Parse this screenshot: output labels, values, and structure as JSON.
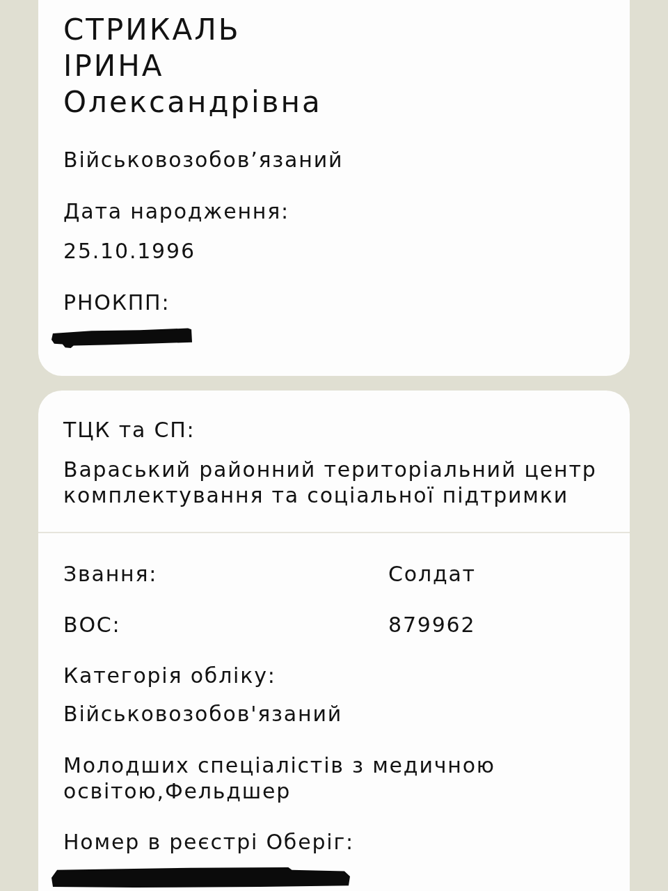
{
  "person_card": {
    "name_lines": [
      "СТРИКАЛЬ",
      "ІРИНА",
      "Олександрівна"
    ],
    "status": "Військовозобов’язаний",
    "fields": [
      {
        "label": "Дата народження:",
        "value": "25.10.1996",
        "redacted": false
      },
      {
        "label": "РНОКПП:",
        "redacted": true
      }
    ]
  },
  "service_card": {
    "tck": {
      "label": "ТЦК та СП:",
      "value": "Вараський районний територіальний центр комплектування та соціальної підтримки"
    },
    "rows": [
      {
        "kind": "inline",
        "label": "Звання:",
        "value": "Солдат"
      },
      {
        "kind": "inline",
        "label": "ВОС:",
        "value": "879962"
      },
      {
        "kind": "stacked",
        "label": "Категорія обліку:",
        "value": "Військовозобов'язаний"
      },
      {
        "kind": "note",
        "value": "Молодших спеціалістів з медичною освітою,Фельдшер"
      },
      {
        "kind": "stacked",
        "label": "Номер в реєстрі Оберіг:",
        "redacted": true
      }
    ]
  }
}
